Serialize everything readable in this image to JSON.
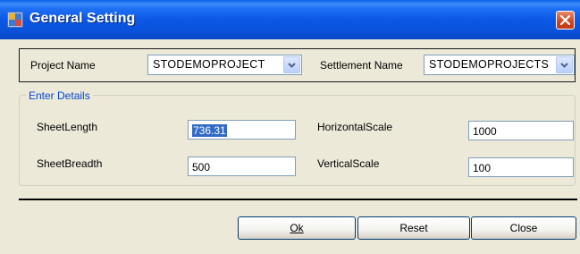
{
  "window": {
    "title": "General Setting"
  },
  "top": {
    "project_label": "Project Name",
    "project_value": "STODEMOPROJECT",
    "settlement_label": "Settlement Name",
    "settlement_value": "STODEMOPROJECTS"
  },
  "details": {
    "legend": "Enter Details",
    "sheet_length_label": "SheetLength",
    "sheet_length_value": "736.31",
    "sheet_breadth_label": "SheetBreadth",
    "sheet_breadth_value": "500",
    "horizontal_scale_label": "HorizontalScale",
    "horizontal_scale_value": "1000",
    "vertical_scale_label": "VerticalScale",
    "vertical_scale_value": "100"
  },
  "buttons": {
    "ok_label": "Ok",
    "reset_label": "Reset",
    "close_label": "Close"
  },
  "icons": {
    "app": "app-window-icon",
    "close": "close-icon",
    "dropdown": "chevron-down-icon"
  },
  "colors": {
    "titlebar": "#0b58e6",
    "close_button": "#d0431d",
    "legend_text": "#0046d5",
    "selection": "#316ac5",
    "dialog_bg": "#ece9d8"
  }
}
